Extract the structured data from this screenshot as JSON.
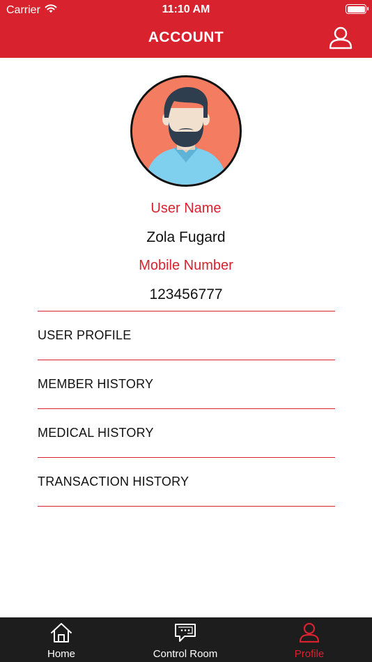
{
  "status_bar": {
    "carrier": "Carrier",
    "time": "11:10 AM",
    "icons": [
      "wifi-icon",
      "battery-icon"
    ]
  },
  "nav": {
    "title": "ACCOUNT",
    "right_icon": "user-icon"
  },
  "profile": {
    "avatar_icon": "avatar-man-icon",
    "username_label": "User Name",
    "username_value": "Zola Fugard",
    "mobile_label": "Mobile Number",
    "mobile_value": "123456777"
  },
  "menu": [
    {
      "label": "USER PROFILE"
    },
    {
      "label": "MEMBER HISTORY"
    },
    {
      "label": "MEDICAL HISTORY"
    },
    {
      "label": "TRANSACTION HISTORY"
    }
  ],
  "tabbar": {
    "tabs": [
      {
        "label": "Home",
        "icon": "home-icon",
        "active": false
      },
      {
        "label": "Control Room",
        "icon": "chat-icon",
        "active": false
      },
      {
        "label": "Profile",
        "icon": "user-icon",
        "active": true
      }
    ]
  },
  "colors": {
    "accent": "#d8222e",
    "tabbar_bg": "#1d1d1d",
    "avatar_bg": "#f47c60"
  }
}
